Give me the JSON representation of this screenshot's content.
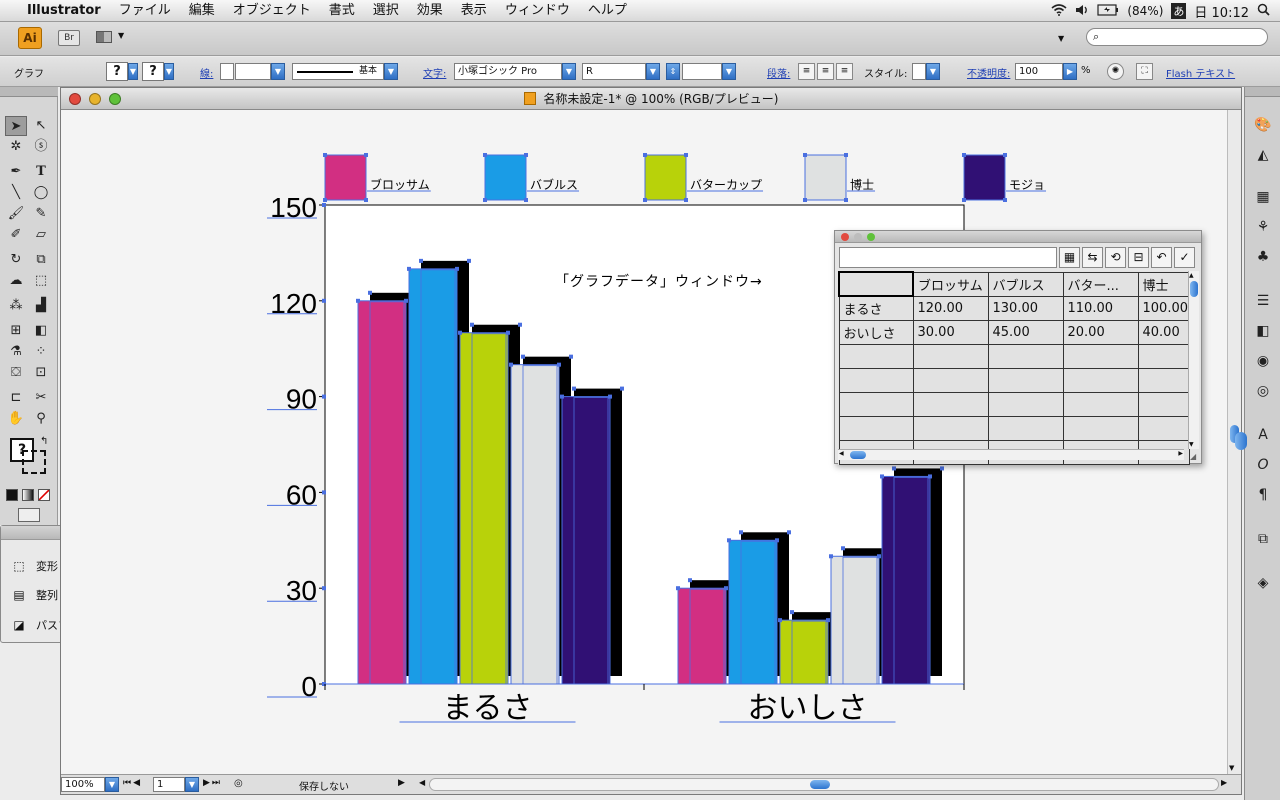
{
  "menubar": {
    "apple": "",
    "app": "Illustrator",
    "items": [
      "ファイル",
      "編集",
      "オブジェクト",
      "書式",
      "選択",
      "効果",
      "表示",
      "ウィンドウ",
      "ヘルプ"
    ],
    "battery": "(84%)",
    "input_method": "あ",
    "clock": "日 10:12"
  },
  "appbar": {
    "ai_badge": "Ai",
    "br_badge": "Br"
  },
  "control": {
    "mode": "グラフ",
    "fill_q": "?",
    "stroke_q": "?",
    "stroke_label": "線:",
    "stroke_style": "基本",
    "char_label": "文字:",
    "font": "小塚ゴシック Pro",
    "font_style": "R",
    "para_label": "段落:",
    "style_label": "スタイル:",
    "opacity_label": "不透明度:",
    "opacity_value": "100",
    "opacity_unit": "%",
    "flash_text": "Flash テキスト"
  },
  "toolbox": {
    "fill_q": "?"
  },
  "floatpanel": {
    "items": [
      "変形",
      "整列",
      "パスファインダ"
    ]
  },
  "document": {
    "title": "名称未設定-1* @ 100% (RGB/プレビュー)",
    "zoom": "100%",
    "page": "1",
    "save_status": "保存しない"
  },
  "chart_data": {
    "type": "bar",
    "categories": [
      "まるさ",
      "おいしさ"
    ],
    "series": [
      {
        "name": "ブロッサム",
        "values": [
          120,
          30
        ],
        "color": "#d22f82"
      },
      {
        "name": "バブルス",
        "values": [
          130,
          45
        ],
        "color": "#1a9ce6"
      },
      {
        "name": "バターカップ",
        "values": [
          110,
          20
        ],
        "color": "#b8d20a"
      },
      {
        "name": "博士",
        "values": [
          100,
          40
        ],
        "color": "#dfe1e1"
      },
      {
        "name": "モジョ",
        "values": [
          90,
          65
        ],
        "color": "#301074"
      }
    ],
    "yticks": [
      0,
      30,
      60,
      90,
      120,
      150
    ],
    "ylim": [
      0,
      150
    ],
    "annotation": "「グラフデータ」ウィンドウ→",
    "legend": "top"
  },
  "datapanel": {
    "rows": [
      [
        "",
        "ブロッサム",
        "バブルス",
        "バター...",
        "博士"
      ],
      [
        "まるさ",
        "120.00",
        "130.00",
        "110.00",
        "100.00"
      ],
      [
        "おいしさ",
        "30.00",
        "45.00",
        "20.00",
        "40.00"
      ]
    ],
    "empty_rows": 5
  }
}
